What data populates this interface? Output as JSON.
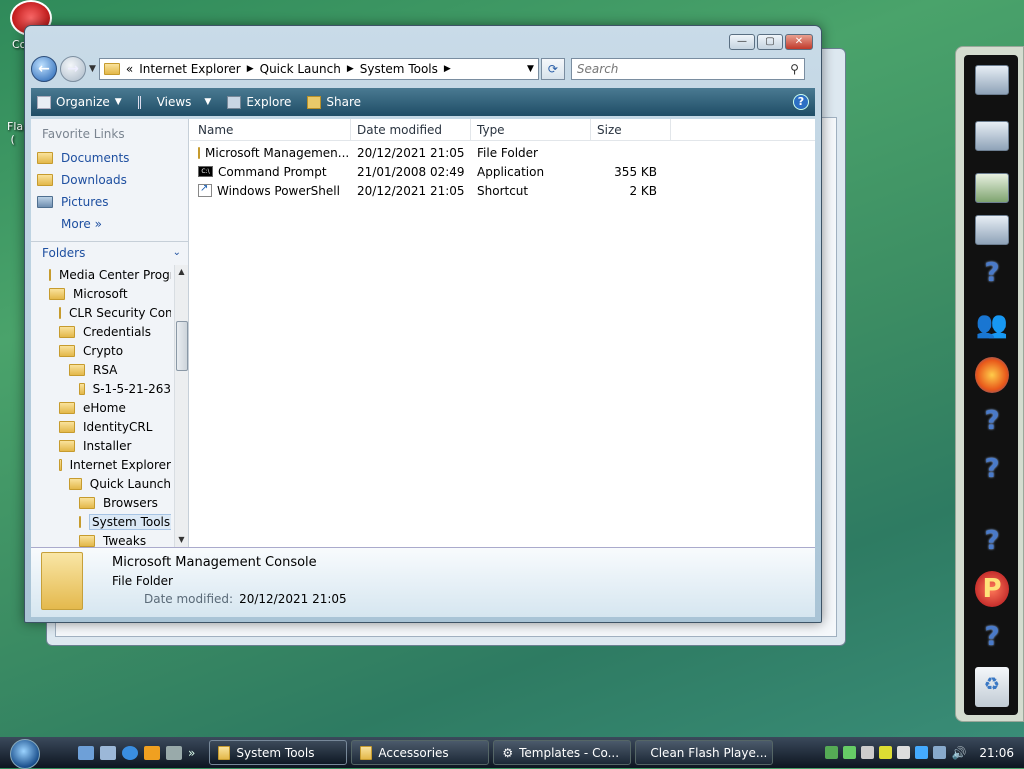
{
  "window": {
    "address": [
      "Internet Explorer",
      "Quick Launch",
      "System Tools"
    ],
    "address_prefix": "«",
    "search_placeholder": "Search"
  },
  "toolbar": {
    "organize": "Organize",
    "views": "Views",
    "explore": "Explore",
    "share": "Share",
    "help": "?"
  },
  "nav": {
    "favorites_title": "Favorite Links",
    "favorites": [
      "Documents",
      "Downloads",
      "Pictures"
    ],
    "more": "More",
    "folders_title": "Folders",
    "tree": [
      {
        "label": "Media Center Programs",
        "indent": 0
      },
      {
        "label": "Microsoft",
        "indent": 0
      },
      {
        "label": "CLR Security Config",
        "indent": 1
      },
      {
        "label": "Credentials",
        "indent": 1
      },
      {
        "label": "Crypto",
        "indent": 1
      },
      {
        "label": "RSA",
        "indent": 2
      },
      {
        "label": "S-1-5-21-263",
        "indent": 3
      },
      {
        "label": "eHome",
        "indent": 1
      },
      {
        "label": "IdentityCRL",
        "indent": 1
      },
      {
        "label": "Installer",
        "indent": 1
      },
      {
        "label": "Internet Explorer",
        "indent": 1
      },
      {
        "label": "Quick Launch",
        "indent": 2
      },
      {
        "label": "Browsers",
        "indent": 3
      },
      {
        "label": "System Tools",
        "indent": 3,
        "selected": true
      },
      {
        "label": "Tweaks",
        "indent": 3
      }
    ]
  },
  "columns": {
    "name": "Name",
    "date": "Date modified",
    "type": "Type",
    "size": "Size"
  },
  "files": [
    {
      "name": "Microsoft Managemen...",
      "date": "20/12/2021 21:05",
      "type": "File Folder",
      "size": "",
      "icon": "folder"
    },
    {
      "name": "Command Prompt",
      "date": "21/01/2008 02:49",
      "type": "Application",
      "size": "355 KB",
      "icon": "cmd"
    },
    {
      "name": "Windows PowerShell",
      "date": "20/12/2021 21:05",
      "type": "Shortcut",
      "size": "2 KB",
      "icon": "shortcut"
    }
  ],
  "details": {
    "name": "Microsoft Management Console",
    "type": "File Folder",
    "modified_label": "Date modified:",
    "modified_value": "20/12/2021 21:05"
  },
  "taskbar": {
    "tasks": [
      "System Tools",
      "Accessories",
      "Templates - Co...",
      "Clean Flash Playe..."
    ],
    "clock": "21:06"
  }
}
